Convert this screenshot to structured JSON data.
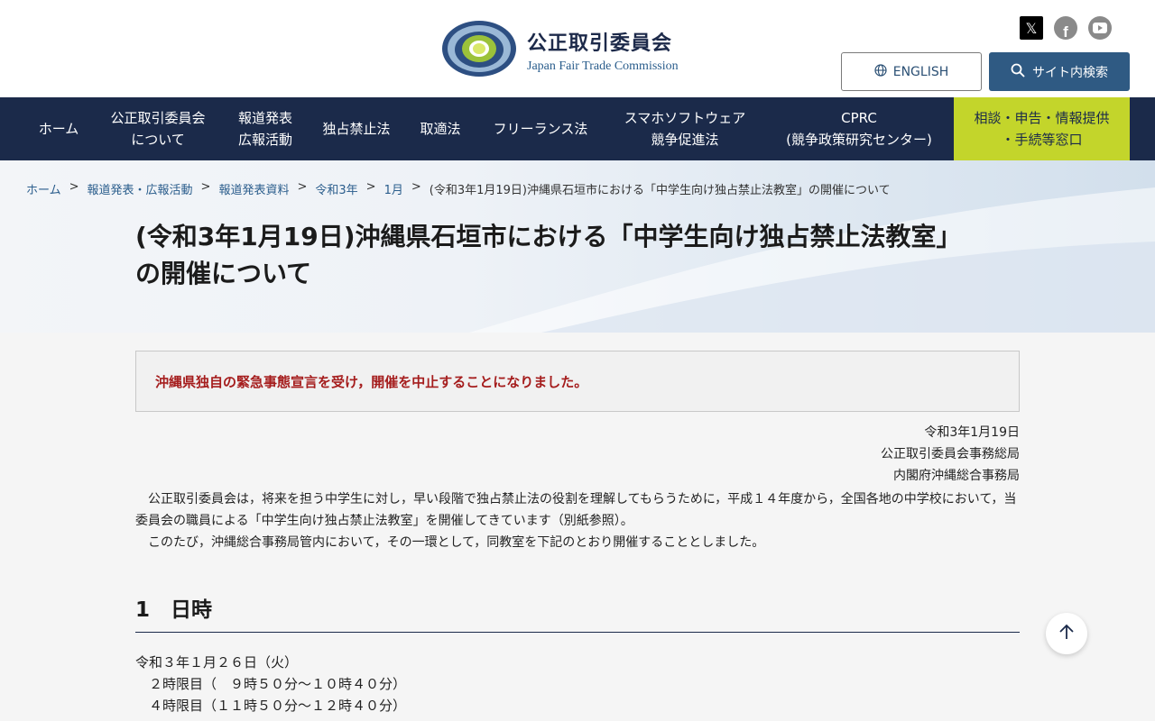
{
  "header": {
    "logo_icon": "jftc-emblem",
    "logo_text_jp": "公正取引委員会",
    "logo_text_en": "Japan Fair Trade Commission",
    "social": [
      {
        "name": "x-icon",
        "glyph": "𝕏"
      },
      {
        "name": "facebook-icon",
        "glyph": "f"
      },
      {
        "name": "youtube-icon",
        "glyph": ""
      }
    ],
    "english_label": "ENGLISH",
    "search_label": "サイト内検索"
  },
  "nav": {
    "items": [
      {
        "line1": "ホーム",
        "line2": ""
      },
      {
        "line1": "公正取引委員会",
        "line2": "について"
      },
      {
        "line1": "報道発表",
        "line2": "広報活動"
      },
      {
        "line1": "独占禁止法",
        "line2": ""
      },
      {
        "line1": "取適法",
        "line2": ""
      },
      {
        "line1": "フリーランス法",
        "line2": ""
      },
      {
        "line1": "スマホソフトウェア",
        "line2": "競争促進法"
      },
      {
        "line1": "CPRC",
        "line2": "(競争政策研究センター)"
      },
      {
        "line1": "相談・申告・情報提供",
        "line2": "・手続等窓口"
      }
    ]
  },
  "breadcrumb": {
    "items": [
      "ホーム",
      "報道発表・広報活動",
      "報道発表資料",
      "令和3年",
      "1月"
    ],
    "current": "(令和3年1月19日)沖縄県石垣市における「中学生向け独占禁止法教室」の開催について",
    "separator": ">"
  },
  "page": {
    "title_line1": "(令和3年1月19日)沖縄県石垣市における「中学生向け独占禁止法教室」",
    "title_line2": "の開催について"
  },
  "content": {
    "notice": "沖縄県独自の緊急事態宣言を受け，開催を中止することになりました。",
    "date": "令和3年1月19日",
    "issuer1": "公正取引委員会事務総局",
    "issuer2": "内閣府沖縄総合事務局",
    "para1": "　公正取引委員会は，将来を担う中学生に対し，早い段階で独占禁止法の役割を理解してもらうために，平成１４年度から，全国各地の中学校において，当委員会の職員による「中学生向け独占禁止法教室」を開催してきています（別紙参照）。",
    "para2": "　このたび，沖縄総合事務局管内において，その一環として，同教室を下記のとおり開催することとしました。",
    "section1_heading": "1　日時",
    "schedule": [
      "令和３年１月２６日（火）",
      "　２時限目（　９時５０分～１０時４０分）",
      "　４時限目（１１時５０分～１２時４０分）"
    ]
  },
  "to_top_icon": "arrow-up-icon"
}
